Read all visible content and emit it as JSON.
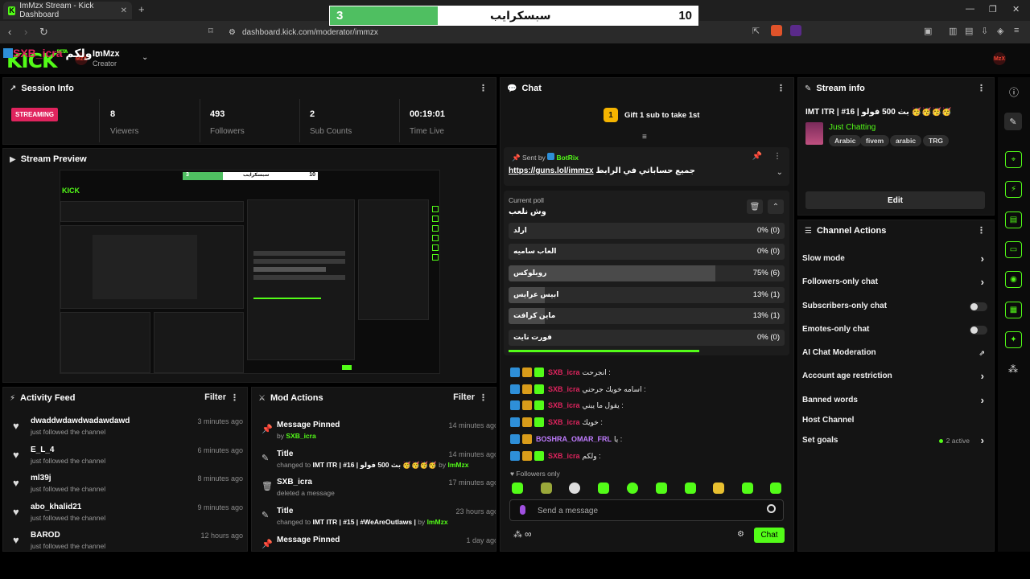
{
  "browser": {
    "tab_title": "ImMzx Stream - Kick Dashboard",
    "url": "dashboard.kick.com/moderator/immzx"
  },
  "overlay_poll": {
    "left_count": "3",
    "title": "سبسكرايب",
    "right_count": "10"
  },
  "header": {
    "logo": "KICK",
    "logo_suffix": "BETA",
    "avatar_text": "MzX",
    "username": "ImMzx",
    "role": "Creator"
  },
  "session": {
    "title": "Session Info",
    "status": "STREAMING",
    "overlay_user": "SXB_icra",
    "overlay_text": "ولكم :",
    "stats": [
      {
        "value": "8",
        "label": "Viewers"
      },
      {
        "value": "493",
        "label": "Followers"
      },
      {
        "value": "2",
        "label": "Sub Counts"
      },
      {
        "value": "00:19:01",
        "label": "Time Live"
      }
    ]
  },
  "preview": {
    "title": "Stream Preview",
    "mini_banner_left": "3",
    "mini_banner_title": "سبسكرايب",
    "mini_banner_right": "10"
  },
  "activity": {
    "title": "Activity Feed",
    "filter": "Filter",
    "items": [
      {
        "name": "dwaddwdawdwadawdawd",
        "sub": "just followed the channel",
        "time": "3 minutes ago"
      },
      {
        "name": "E_L_4",
        "sub": "just followed the channel",
        "time": "6 minutes ago"
      },
      {
        "name": "ml39j",
        "sub": "just followed the channel",
        "time": "8 minutes ago"
      },
      {
        "name": "abo_khalid21",
        "sub": "just followed the channel",
        "time": "9 minutes ago"
      },
      {
        "name": "BAROD",
        "sub": "just followed the channel",
        "time": "12 hours ago"
      }
    ]
  },
  "mod": {
    "title": "Mod Actions",
    "filter": "Filter",
    "items": [
      {
        "title": "Message Pinned",
        "pre": "by",
        "bold": "",
        "mid": "",
        "user": "SXB_icra",
        "time": "14 minutes ago"
      },
      {
        "title": "Title",
        "pre": "changed to",
        "bold": "IMT ITR | #16 | بث 500 فولو 🥳🥳🥳🥳",
        "mid": "by",
        "user": "ImMzx",
        "time": "14 minutes ago"
      },
      {
        "title": "SXB_icra",
        "pre": "deleted a message",
        "bold": "",
        "mid": "",
        "user": "",
        "time": "17 minutes ago"
      },
      {
        "title": "Title",
        "pre": "changed to",
        "bold": "IMT ITR | #15 | #WeAreOutlaws |",
        "mid": "by",
        "user": "ImMzx",
        "time": "23 hours ago"
      },
      {
        "title": "Message Pinned",
        "pre": "",
        "bold": "",
        "mid": "",
        "user": "",
        "time": "1 day ago"
      }
    ]
  },
  "chat": {
    "title": "Chat",
    "gift_text": "Gift 1 sub to take 1st",
    "gift_rank": "1",
    "pinned_by_label": "Sent by",
    "pinned_by": "BotRix",
    "pinned_link": "https://guns.lol/immzx",
    "pinned_text": "جميع حساباتي في الرابط",
    "poll_label": "Current poll",
    "poll_question": "وش نلعب",
    "poll_options": [
      {
        "label": "ارلد",
        "percent": 0,
        "display": "0% (0)"
      },
      {
        "label": "العاب ساميه",
        "percent": 0,
        "display": "0% (0)"
      },
      {
        "label": "روبلوكس",
        "percent": 75,
        "display": "75% (6)"
      },
      {
        "label": "ابيس عرايس",
        "percent": 13,
        "display": "13% (1)"
      },
      {
        "label": "ماين كرافت",
        "percent": 13,
        "display": "13% (1)"
      },
      {
        "label": "فورت نايت",
        "percent": 0,
        "display": "0% (0)"
      }
    ],
    "messages": [
      {
        "user": "SXB_icra",
        "color": "#e0245e",
        "text": "انجرحت :"
      },
      {
        "user": "SXB_icra",
        "color": "#e0245e",
        "text": "اسامه خويك جرحني :"
      },
      {
        "user": "SXB_icra",
        "color": "#e0245e",
        "text": "يقول ما يبني :"
      },
      {
        "user": "SXB_icra",
        "color": "#e0245e",
        "text": "خويك :"
      },
      {
        "user": "BOSHRA_OMAR_FRL",
        "color": "#c07cff",
        "text": "يا :"
      },
      {
        "user": "SXB_icra",
        "color": "#e0245e",
        "text": "ولكم :"
      }
    ],
    "followers_only": "Followers only",
    "input_placeholder": "Send a message",
    "send_label": "Chat"
  },
  "stream_info": {
    "title": "Stream info",
    "stream_title": "IMT ITR | #16 | بث 500 فولو 🥳🥳🥳🥳",
    "category": "Just Chatting",
    "tags": [
      "Arabic",
      "fivem",
      "arabic",
      "TRG"
    ],
    "edit_label": "Edit"
  },
  "channel_actions": {
    "title": "Channel Actions",
    "items": [
      {
        "label": "Slow mode",
        "kind": "arrow"
      },
      {
        "label": "Followers-only chat",
        "kind": "arrow"
      },
      {
        "label": "Subscribers-only chat",
        "kind": "toggle"
      },
      {
        "label": "Emotes-only chat",
        "kind": "toggle"
      },
      {
        "label": "AI Chat Moderation",
        "kind": "external"
      },
      {
        "label": "Account age restriction",
        "kind": "arrow"
      },
      {
        "label": "Banned words",
        "kind": "arrow"
      },
      {
        "label": "Host Channel",
        "kind": "none"
      },
      {
        "label": "Set goals",
        "kind": "arrow",
        "status": "2 active"
      }
    ]
  }
}
